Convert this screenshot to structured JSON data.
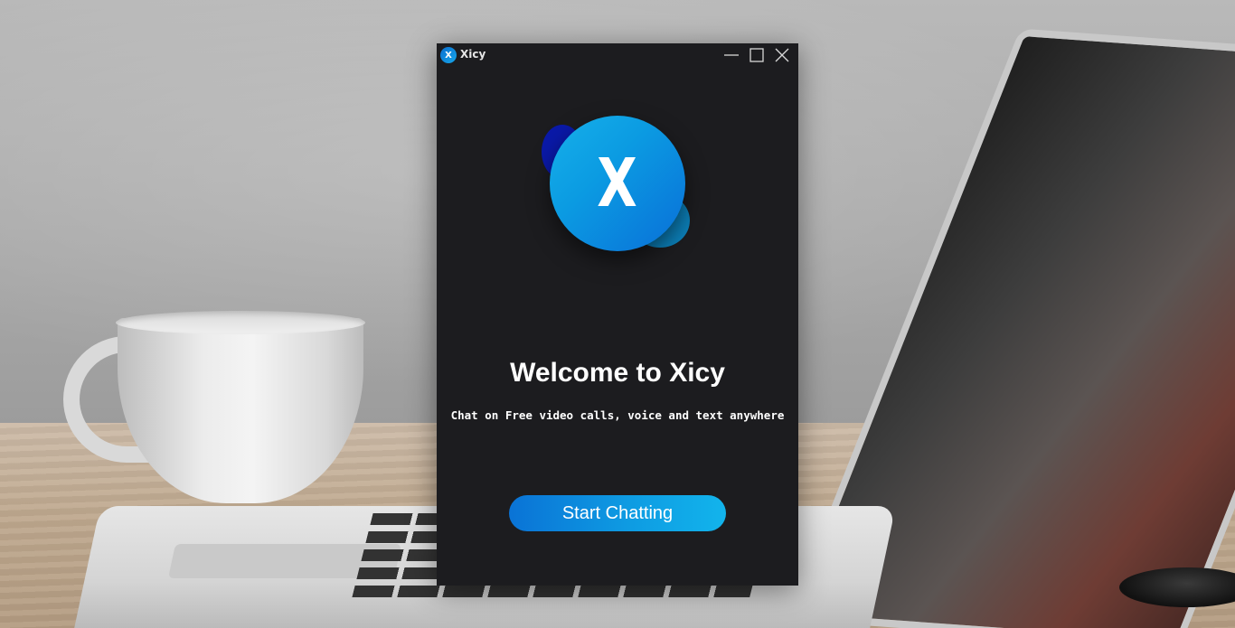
{
  "app": {
    "title": "Xicy",
    "icon_letter": "X",
    "logo_letter": "X"
  },
  "window_controls": {
    "minimize_icon": "minimize-icon",
    "maximize_icon": "maximize-icon",
    "close_icon": "close-icon"
  },
  "welcome": {
    "title": "Welcome to Xicy",
    "subtitle": "Chat on Free video calls, voice and text anywhere",
    "button_label": "Start Chatting"
  },
  "colors": {
    "window_bg": "#1c1c1f",
    "accent_start": "#0a73d6",
    "accent_end": "#12b4ec",
    "logo_blob_dark": "#0a19a8",
    "logo_blob_teal": "#0c7fb8"
  }
}
